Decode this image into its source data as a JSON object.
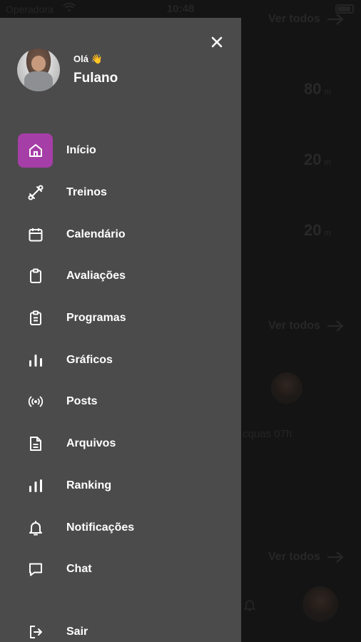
{
  "status_bar": {
    "carrier": "Operadora",
    "time": "10:48"
  },
  "background": {
    "link_label": "Ver todos",
    "stats": [
      {
        "value": "80",
        "unit": "m"
      },
      {
        "value": "20",
        "unit": "m"
      },
      {
        "value": "20",
        "unit": "m"
      }
    ],
    "time_text": "cquas 07h"
  },
  "drawer": {
    "greeting": "Olá 👋",
    "user_name": "Fulano",
    "menu": [
      {
        "label": "Início",
        "icon": "home-icon",
        "active": true
      },
      {
        "label": "Treinos",
        "icon": "dumbbell-icon",
        "active": false
      },
      {
        "label": "Calendário",
        "icon": "calendar-icon",
        "active": false
      },
      {
        "label": "Avaliações",
        "icon": "clipboard-icon",
        "active": false
      },
      {
        "label": "Programas",
        "icon": "clipboard-list-icon",
        "active": false
      },
      {
        "label": "Gráficos",
        "icon": "bar-chart-icon",
        "active": false
      },
      {
        "label": "Posts",
        "icon": "broadcast-icon",
        "active": false
      },
      {
        "label": "Arquivos",
        "icon": "file-icon",
        "active": false
      },
      {
        "label": "Ranking",
        "icon": "ranking-icon",
        "active": false
      },
      {
        "label": "Notificações",
        "icon": "bell-icon",
        "active": false
      },
      {
        "label": "Chat",
        "icon": "chat-icon",
        "active": false
      }
    ],
    "logout_label": "Sair"
  },
  "colors": {
    "accent": "#a63ea7",
    "drawer_bg": "#4b4b4b",
    "text": "#ffffff"
  }
}
